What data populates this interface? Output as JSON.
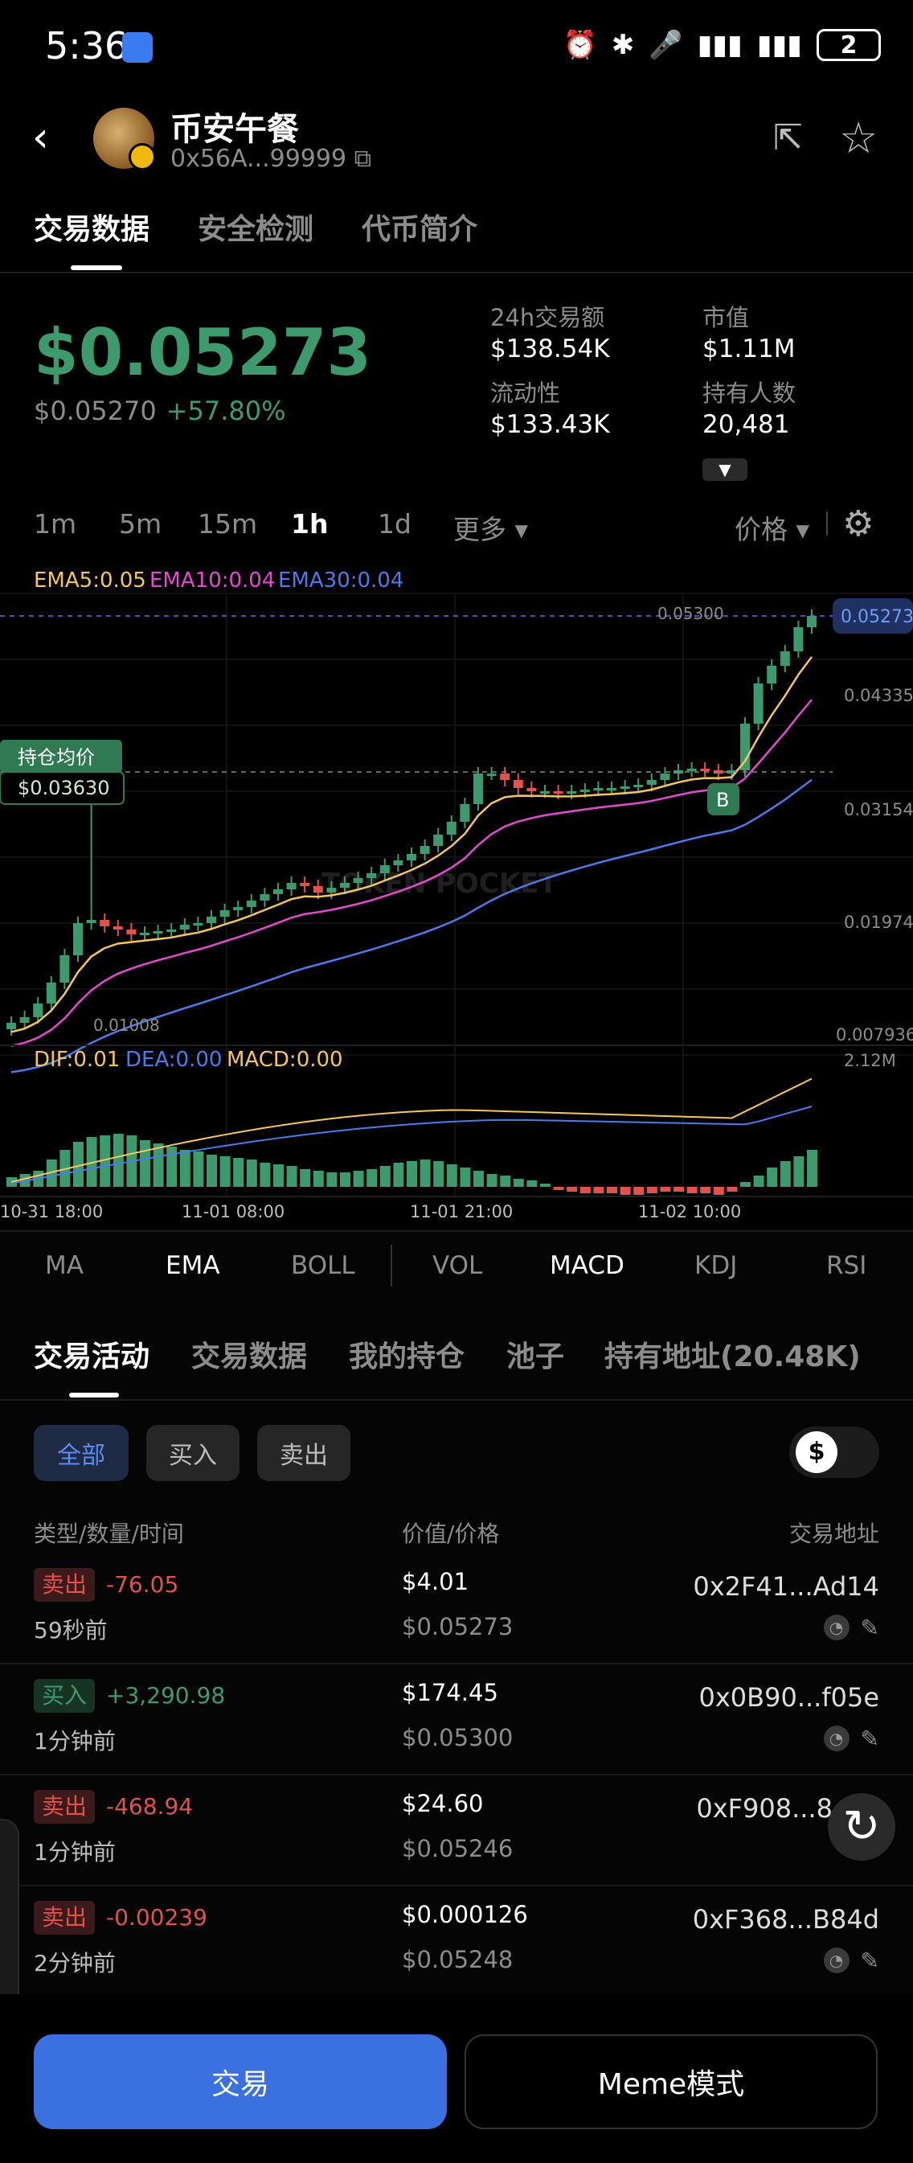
{
  "status_bar": {
    "time": "5:36",
    "battery": "2"
  },
  "token": {
    "name": "币安午餐",
    "address": "0x56A...99999"
  },
  "main_tabs": [
    {
      "label": "交易数据",
      "active": true
    },
    {
      "label": "安全检测",
      "active": false
    },
    {
      "label": "代币简介",
      "active": false
    }
  ],
  "price": {
    "main": "$0.05273",
    "sub": "$0.05270",
    "change": "+57.80%"
  },
  "stats": {
    "volume_label": "24h交易额",
    "volume_value": "$138.54K",
    "mcap_label": "市值",
    "mcap_value": "$1.11M",
    "liquidity_label": "流动性",
    "liquidity_value": "$133.43K",
    "holders_label": "持有人数",
    "holders_value": "20,481"
  },
  "timeframes": [
    {
      "label": "1m",
      "active": false
    },
    {
      "label": "5m",
      "active": false
    },
    {
      "label": "15m",
      "active": false
    },
    {
      "label": "1h",
      "active": true
    },
    {
      "label": "1d",
      "active": false
    },
    {
      "label": "更多 ▾",
      "active": false
    }
  ],
  "price_type_label": "价格 ▾",
  "chart_data": {
    "type": "candlestick",
    "legend": {
      "ema5": "EMA5:0.05",
      "ema10": "EMA10:0.04",
      "ema30": "EMA30:0.04"
    },
    "y_ticks": [
      "0.04335",
      "0.03154",
      "0.01974",
      "0.007936"
    ],
    "current_price_label": "0.05273",
    "high_label": "0.05300",
    "low_label": "0.01008",
    "avg_cost": {
      "label": "持仓均价",
      "value": "$0.03630"
    },
    "buy_marker": "B",
    "watermark": "TOKEN POCKET",
    "x_labels": [
      "10-31 18:00",
      "11-01 08:00",
      "11-01 21:00",
      "11-02 10:00"
    ],
    "colors": {
      "up": "#3d9a6c",
      "down": "#e0524a",
      "ema5": "#f5c65a",
      "ema10": "#e34ad0",
      "ema30": "#4a7be8"
    },
    "macd_legend": {
      "dif": "DIF:0.01",
      "dea": "DEA:0.00",
      "macd": "MACD:0.00"
    },
    "macd_max_label": "2.12M"
  },
  "indicator_tabs": [
    {
      "label": "MA",
      "active": false
    },
    {
      "label": "EMA",
      "active": true
    },
    {
      "label": "BOLL",
      "active": false
    },
    {
      "label": "VOL",
      "active": false
    },
    {
      "label": "MACD",
      "active": true
    },
    {
      "label": "KDJ",
      "active": false
    },
    {
      "label": "RSI",
      "active": false
    }
  ],
  "activity_tabs": [
    {
      "label": "交易活动",
      "active": true
    },
    {
      "label": "交易数据",
      "active": false
    },
    {
      "label": "我的持仓",
      "active": false
    },
    {
      "label": "池子",
      "active": false
    },
    {
      "label": "持有地址(20.48K)",
      "active": false
    }
  ],
  "filters": {
    "all": "全部",
    "buy": "买入",
    "sell": "卖出",
    "toggle_symbol": "$"
  },
  "table_headers": {
    "type": "类型/数量/时间",
    "value": "价值/价格",
    "address": "交易地址"
  },
  "trades": [
    {
      "type": "卖出",
      "side": "sell",
      "qty": "-76.05",
      "time": "59秒前",
      "value": "$4.01",
      "price": "$0.05273",
      "address": "0x2F41...Ad14"
    },
    {
      "type": "买入",
      "side": "buy",
      "qty": "+3,290.98",
      "time": "1分钟前",
      "value": "$174.45",
      "price": "$0.05300",
      "address": "0x0B90...f05e"
    },
    {
      "type": "卖出",
      "side": "sell",
      "qty": "-468.94",
      "time": "1分钟前",
      "value": "$24.60",
      "price": "$0.05246",
      "address": "0xF908...8"
    },
    {
      "type": "卖出",
      "side": "sell",
      "qty": "-0.00239",
      "time": "2分钟前",
      "value": "$0.000126",
      "price": "$0.05248",
      "address": "0xF368...B84d"
    }
  ],
  "buttons": {
    "trade": "交易",
    "meme": "Meme模式"
  }
}
